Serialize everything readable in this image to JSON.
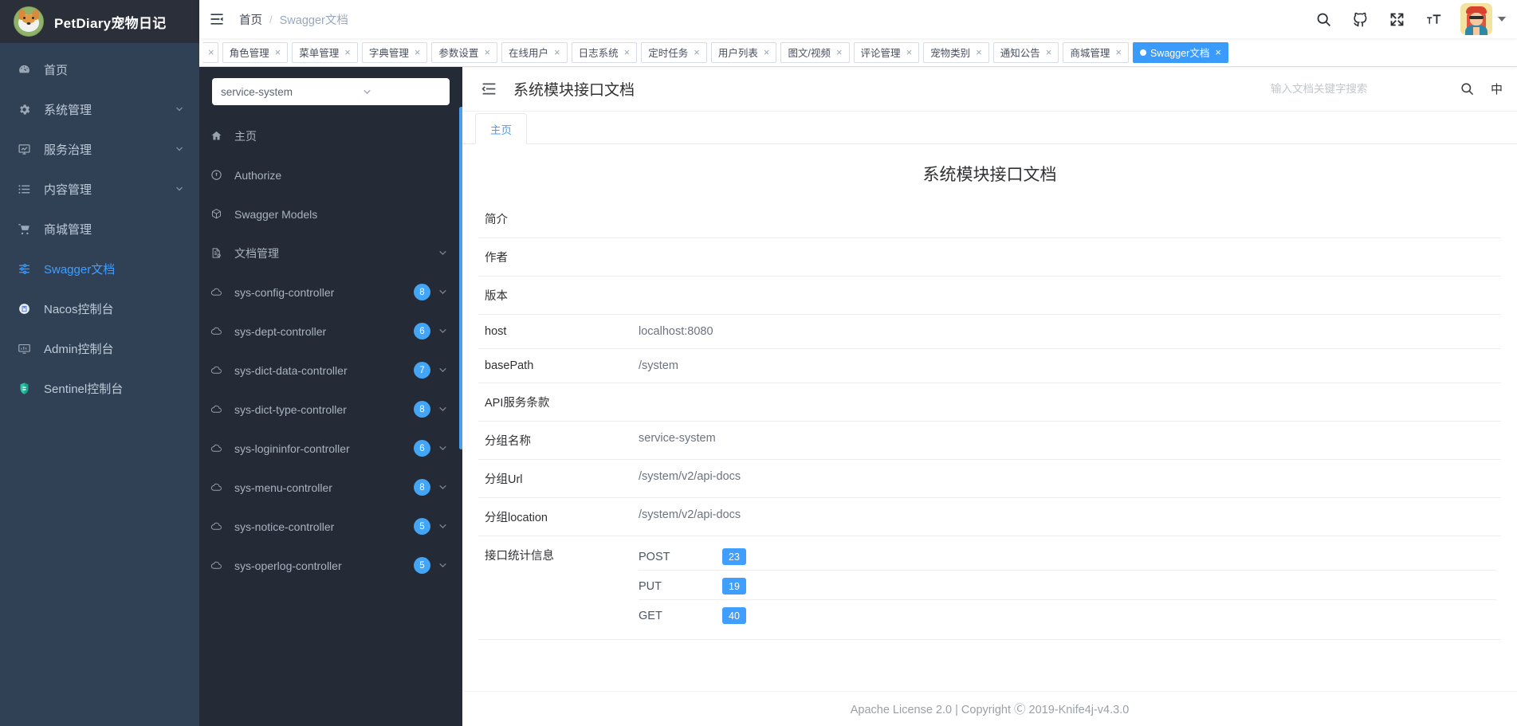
{
  "brand": {
    "title": "PetDiary宠物日记",
    "logo_icon": "dog-avatar-icon"
  },
  "sidebar": {
    "items": [
      {
        "label": "首页",
        "icon": "dashboard-icon",
        "active": false,
        "has_arrow": false
      },
      {
        "label": "系统管理",
        "icon": "gear-icon",
        "active": false,
        "has_arrow": true
      },
      {
        "label": "服务治理",
        "icon": "monitor-chart-icon",
        "active": false,
        "has_arrow": true
      },
      {
        "label": "内容管理",
        "icon": "list-icon",
        "active": false,
        "has_arrow": true
      },
      {
        "label": "商城管理",
        "icon": "shopping-cart-icon",
        "active": false,
        "has_arrow": false
      },
      {
        "label": "Swagger文档",
        "icon": "sliders-icon",
        "active": true,
        "has_arrow": false
      },
      {
        "label": "Nacos控制台",
        "icon": "nacos-icon",
        "active": false,
        "has_arrow": false
      },
      {
        "label": "Admin控制台",
        "icon": "desktop-icon",
        "active": false,
        "has_arrow": false
      },
      {
        "label": "Sentinel控制台",
        "icon": "sentinel-shield-icon",
        "active": false,
        "has_arrow": false
      }
    ]
  },
  "navbar": {
    "hamburger_icon": "hamburger-collapse-icon",
    "breadcrumb": {
      "home": "首页",
      "separator": "/",
      "current": "Swagger文档"
    },
    "icons": [
      {
        "name": "search-icon"
      },
      {
        "name": "github-icon"
      },
      {
        "name": "fullscreen-icon"
      },
      {
        "name": "font-size-icon"
      }
    ],
    "avatar_icon": "user-avatar",
    "caret_icon": "chevron-down-icon"
  },
  "tags": [
    {
      "label": "",
      "clipped": true,
      "active": false
    },
    {
      "label": "角色管理",
      "active": false
    },
    {
      "label": "菜单管理",
      "active": false
    },
    {
      "label": "字典管理",
      "active": false
    },
    {
      "label": "参数设置",
      "active": false
    },
    {
      "label": "在线用户",
      "active": false
    },
    {
      "label": "日志系统",
      "active": false
    },
    {
      "label": "定时任务",
      "active": false
    },
    {
      "label": "用户列表",
      "active": false
    },
    {
      "label": "图文/视频",
      "active": false
    },
    {
      "label": "评论管理",
      "active": false
    },
    {
      "label": "宠物类别",
      "active": false
    },
    {
      "label": "通知公告",
      "active": false
    },
    {
      "label": "商城管理",
      "active": false
    },
    {
      "label": "Swagger文档",
      "active": true
    }
  ],
  "knife4j": {
    "service_select": {
      "value": "service-system",
      "chevron_icon": "chevron-down-icon"
    },
    "menu": [
      {
        "label": "主页",
        "icon": "home-icon",
        "badge": null,
        "chevron": false
      },
      {
        "label": "Authorize",
        "icon": "lock-icon",
        "badge": null,
        "chevron": false
      },
      {
        "label": "Swagger Models",
        "icon": "cube-icon",
        "badge": null,
        "chevron": false
      },
      {
        "label": "文档管理",
        "icon": "document-gear-icon",
        "badge": null,
        "chevron": true
      },
      {
        "label": "sys-config-controller",
        "icon": "cloud-api-icon",
        "badge": "8",
        "chevron": true
      },
      {
        "label": "sys-dept-controller",
        "icon": "cloud-api-icon",
        "badge": "6",
        "chevron": true
      },
      {
        "label": "sys-dict-data-controller",
        "icon": "cloud-api-icon",
        "badge": "7",
        "chevron": true
      },
      {
        "label": "sys-dict-type-controller",
        "icon": "cloud-api-icon",
        "badge": "8",
        "chevron": true
      },
      {
        "label": "sys-logininfor-controller",
        "icon": "cloud-api-icon",
        "badge": "6",
        "chevron": true
      },
      {
        "label": "sys-menu-controller",
        "icon": "cloud-api-icon",
        "badge": "8",
        "chevron": true
      },
      {
        "label": "sys-notice-controller",
        "icon": "cloud-api-icon",
        "badge": "5",
        "chevron": true
      },
      {
        "label": "sys-operlog-controller",
        "icon": "cloud-api-icon",
        "badge": "5",
        "chevron": true
      }
    ],
    "header": {
      "collapse_icon": "menu-fold-icon",
      "title": "系统模块接口文档",
      "search_placeholder": "输入文档关键字搜索",
      "search_value": "",
      "search_icon": "search-icon",
      "language_toggle": "中"
    },
    "tabs": [
      {
        "label": "主页",
        "active": true
      }
    ],
    "doc": {
      "title": "系统模块接口文档",
      "rows": [
        {
          "key": "简介",
          "value": ""
        },
        {
          "key": "作者",
          "value": ""
        },
        {
          "key": "版本",
          "value": ""
        },
        {
          "key": "host",
          "value": "localhost:8080"
        },
        {
          "key": "basePath",
          "value": "/system"
        },
        {
          "key": "API服务条款",
          "value": ""
        },
        {
          "key": "分组名称",
          "value": "service-system"
        },
        {
          "key": "分组Url",
          "value": "/system/v2/api-docs"
        },
        {
          "key": "分组location",
          "value": "/system/v2/api-docs"
        }
      ],
      "stats_label": "接口统计信息",
      "stats": [
        {
          "method": "POST",
          "count": "23"
        },
        {
          "method": "PUT",
          "count": "19"
        },
        {
          "method": "GET",
          "count": "40"
        }
      ]
    },
    "footer": "Apache License 2.0 | Copyright Ⓒ 2019-Knife4j-v4.3.0"
  },
  "colors": {
    "sidebar_bg": "#304156",
    "knife_sidebar_bg": "#242b36",
    "accent": "#409eff",
    "badge": "#42a5f5",
    "active_tag": "#3a9bfc"
  }
}
